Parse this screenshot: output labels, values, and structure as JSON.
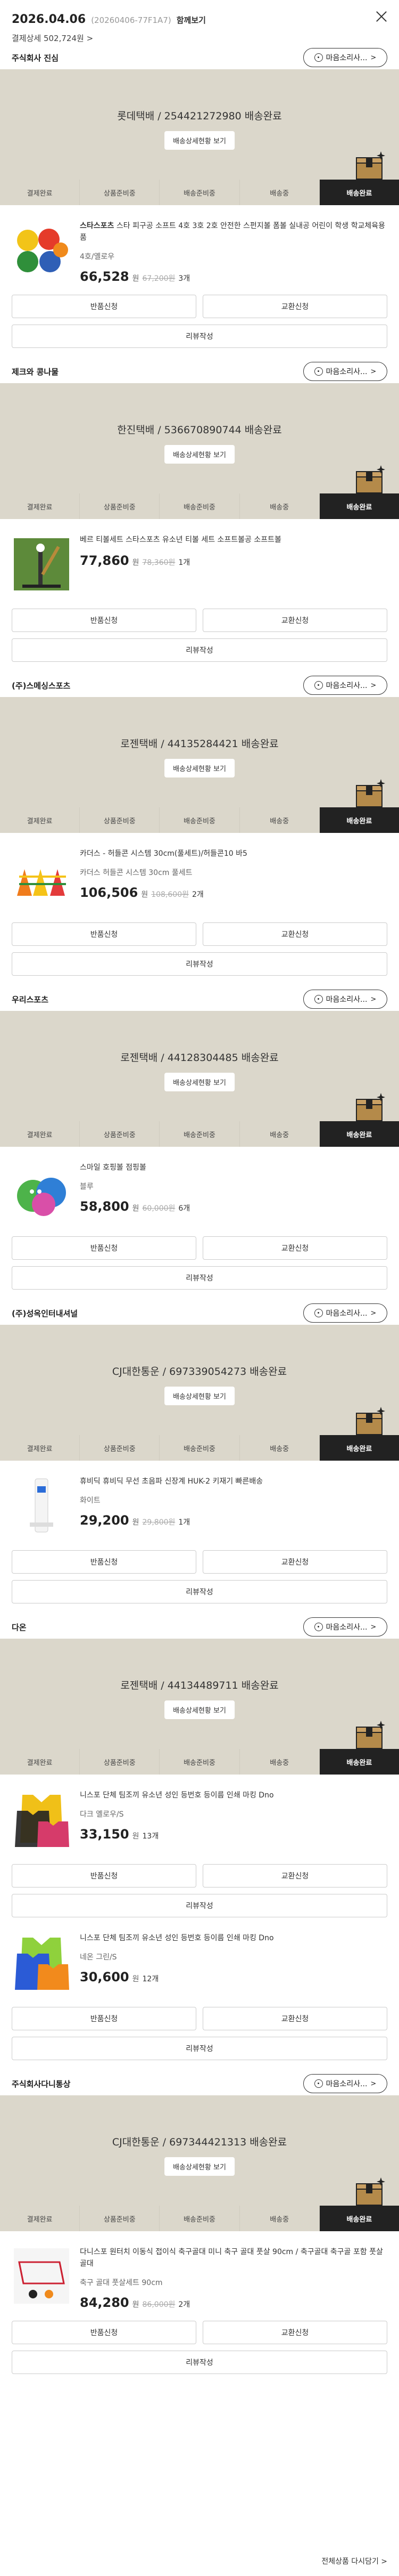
{
  "header": {
    "date": "2026.04.06",
    "order_no": "(20260406-77F1A7)",
    "summary_link": "함께보기",
    "total": "결제상세 502,724원 >"
  },
  "chat_label": "마음소리사...",
  "chat_arrow": ">",
  "buttons": {
    "return": "반품신청",
    "exchange": "교환신청",
    "review": "리뷰작성",
    "detail": "배송상세현황 보기"
  },
  "steps": [
    "결제완료",
    "상품준비중",
    "배송준비중",
    "배송중",
    "배송완료"
  ],
  "shipments": [
    {
      "seller": "주식회사 진심",
      "tracking": "롯데택배 / 254421272980 배송완료",
      "items": [
        {
          "brand": "스타스포츠",
          "name": " 스타 피구공 소프트 4호 3호 2호 안전한 스펀지볼 폼볼 실내공 어린이 학생 학교체육용품",
          "option": "4호/옐로우",
          "price": "66,528",
          "won": "원",
          "orig": "67,200원",
          "qty": "3개",
          "thumb": "balls"
        }
      ]
    },
    {
      "seller": "제크와 콩나물",
      "tracking": "한진택배 / 536670890744 배송완료",
      "items": [
        {
          "brand": "",
          "name": "베르 티볼세트 스타스포츠 유소년 티볼 세트 소프트볼공 소프트볼",
          "option": "",
          "price": "77,860",
          "won": "원",
          "orig": "78,360원",
          "qty": "1개",
          "thumb": "tball"
        }
      ]
    },
    {
      "seller": "(주)스메싱스포츠",
      "tracking": "로젠택배 / 44135284421 배송완료",
      "items": [
        {
          "brand": "",
          "name": "카더스 - 허들콘 시스템 30cm(풀세트)/허들콘10 바5",
          "option": "카더스 허들콘 시스템 30cm 풀세트",
          "price": "106,506",
          "won": "원",
          "orig": "108,600원",
          "qty": "2개",
          "thumb": "hurdle"
        }
      ]
    },
    {
      "seller": "우리스포츠",
      "tracking": "로젠택배 / 44128304485 배송완료",
      "items": [
        {
          "brand": "",
          "name": "스마일 호핑볼 점핑볼",
          "option": "블루",
          "price": "58,800",
          "won": "원",
          "orig": "60,000원",
          "qty": "6개",
          "thumb": "hop"
        }
      ]
    },
    {
      "seller": "(주)성옥인터내셔널",
      "tracking": "CJ대한통운 / 697339054273 배송완료",
      "items": [
        {
          "brand": "",
          "name": "휴비딕 휴비딕 무선 초음파 신장계 HUK-2 키재기 빠른배송",
          "option": "화이트",
          "price": "29,200",
          "won": "원",
          "orig": "29,800원",
          "qty": "1개",
          "thumb": "meter"
        }
      ]
    },
    {
      "seller": "다온",
      "tracking": "로젠택배 / 44134489711 배송완료",
      "items": [
        {
          "brand": "",
          "name": "니스포 단체 팀조끼 유소년 성인 등번호 등이름 인쇄 마킹 Dno",
          "option": "다크 옐로우/S",
          "price": "33,150",
          "won": "원",
          "orig": "",
          "qty": "13개",
          "thumb": "vest"
        },
        {
          "brand": "",
          "name": "니스포 단체 팀조끼 유소년 성인 등번호 등이름 인쇄 마킹 Dno",
          "option": "네온 그린/S",
          "price": "30,600",
          "won": "원",
          "orig": "",
          "qty": "12개",
          "thumb": "vest2"
        }
      ]
    },
    {
      "seller": "주식회사다니통상",
      "tracking": "CJ대한통운 / 697344421313 배송완료",
      "items": [
        {
          "brand": "",
          "name": "다니스포 원터치 이동식 접이식 축구골대 미니 축구 골대 풋살 90cm / 축구골대 축구골 포함 풋살골대",
          "option": "축구 골대 풋살세트 90cm",
          "price": "84,280",
          "won": "원",
          "orig": "86,000원",
          "qty": "2개",
          "thumb": "goal"
        }
      ]
    }
  ],
  "footer": "전체상품 다시담기 >"
}
